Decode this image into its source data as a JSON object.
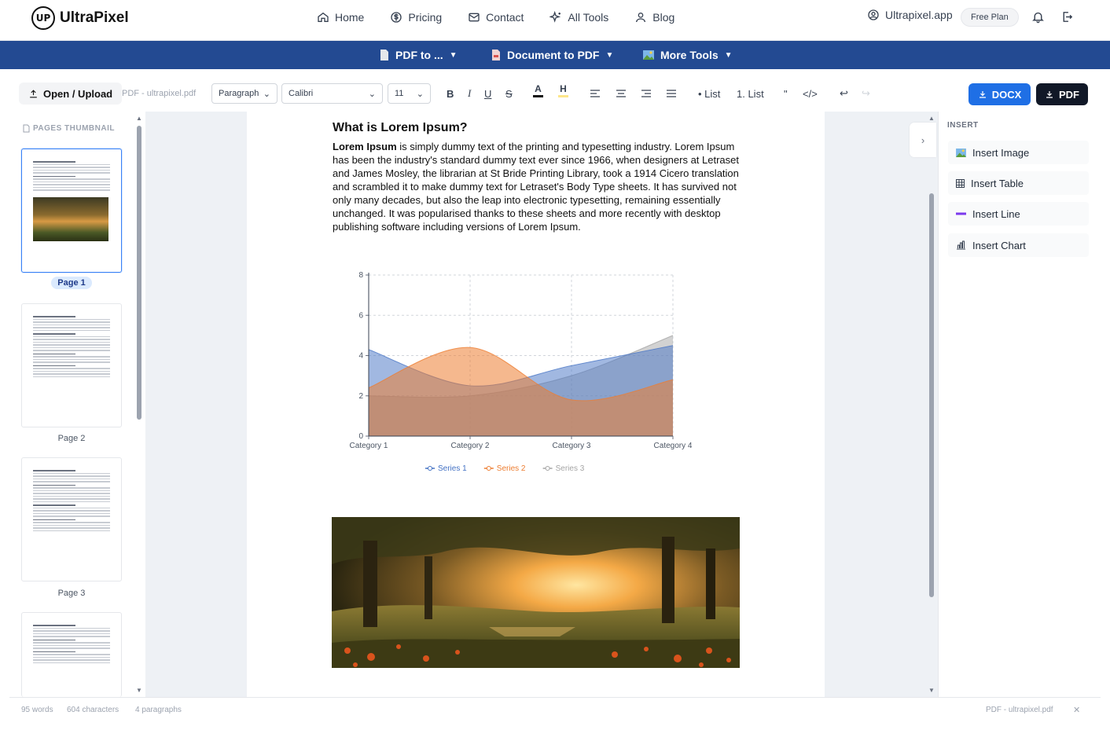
{
  "brand": {
    "logo_mark": "UP",
    "name": "UltraPixel"
  },
  "nav": {
    "items": [
      {
        "label": "Home",
        "icon": "home-icon"
      },
      {
        "label": "Pricing",
        "icon": "dollar-icon"
      },
      {
        "label": "Contact",
        "icon": "mail-icon"
      },
      {
        "label": "All Tools",
        "icon": "sparkle-icon"
      },
      {
        "label": "Blog",
        "icon": "user-icon"
      }
    ],
    "account": "Ultrapixel.app",
    "plan": "Free Plan"
  },
  "toolsbar": {
    "items": [
      {
        "label": "PDF to ...",
        "icon": "file-icon"
      },
      {
        "label": "Document to PDF",
        "icon": "file-pdf-icon"
      },
      {
        "label": "More Tools",
        "icon": "image-icon"
      }
    ]
  },
  "toolbar": {
    "open_label": "Open / Upload",
    "filename": "PDF - ultrapixel.pdf",
    "block_style": "Paragraph",
    "font": "Calibri",
    "font_size": "11",
    "bold": "B",
    "italic": "I",
    "underline": "U",
    "strike": "S",
    "text_color": "A",
    "highlight": "H",
    "bullet_list": "• List",
    "numbered_list": "1. List",
    "quote": "\"",
    "code": "</>",
    "undo": "↩",
    "redo": "↪",
    "docx_label": "DOCX",
    "pdf_label": "PDF"
  },
  "thumbnails": {
    "title": "PAGES THUMBNAIL",
    "pages": [
      "Page 1",
      "Page 2",
      "Page 3"
    ]
  },
  "document": {
    "heading": "What is Lorem Ipsum?",
    "lead_bold": "Lorem Ipsum",
    "body": " is simply dummy text of the printing and typesetting industry. Lorem Ipsum has been the industry's standard dummy text ever since 1966, when designers at Letraset and James Mosley, the librarian at St Bride Printing Library, took a 1914 Cicero translation and scrambled it to make dummy text for Letraset's Body Type sheets. It has survived not only many decades, but also the leap into electronic typesetting, remaining essentially unchanged. It was popularised thanks to these sheets and more recently with desktop publishing software including versions of Lorem Ipsum."
  },
  "chart_data": {
    "type": "area",
    "title": "",
    "xlabel": "",
    "ylabel": "",
    "categories": [
      "Category 1",
      "Category 2",
      "Category 3",
      "Category 4"
    ],
    "ylim": [
      0,
      8
    ],
    "yticks": [
      0,
      2,
      4,
      6,
      8
    ],
    "grid": true,
    "legend_position": "bottom",
    "series": [
      {
        "name": "Series 1",
        "values": [
          4.3,
          2.5,
          3.5,
          4.5
        ],
        "color": "#4472c4"
      },
      {
        "name": "Series 2",
        "values": [
          2.4,
          4.4,
          1.8,
          2.8
        ],
        "color": "#ed7d31"
      },
      {
        "name": "Series 3",
        "values": [
          2,
          2,
          3,
          5
        ],
        "color": "#a5a5a5"
      }
    ]
  },
  "insert_panel": {
    "title": "INSERT",
    "items": [
      {
        "label": "Insert Image",
        "icon": "image-icon"
      },
      {
        "label": "Insert Table",
        "icon": "table-icon"
      },
      {
        "label": "Insert Line",
        "icon": "line-icon"
      },
      {
        "label": "Insert Chart",
        "icon": "chart-icon"
      }
    ]
  },
  "footer": {
    "words": "95 words",
    "characters": "604 characters",
    "paragraphs": "4 paragraphs",
    "file": "PDF - ultrapixel.pdf",
    "close": "✕"
  }
}
